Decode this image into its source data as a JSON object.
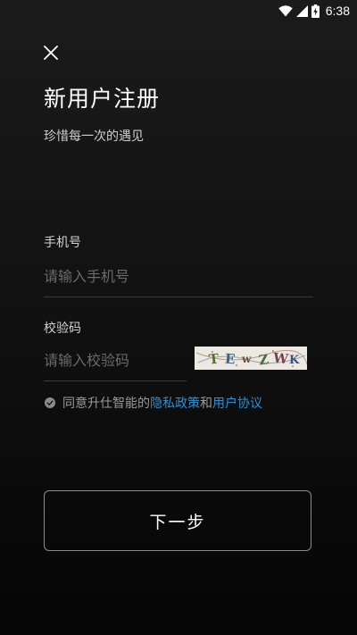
{
  "status_bar": {
    "time": "6:38",
    "icons": [
      "wifi-icon",
      "signal-icon",
      "battery-charging-icon"
    ]
  },
  "header": {
    "close_icon": "close-icon",
    "title": "新用户注册",
    "subtitle": "珍惜每一次的遇见"
  },
  "form": {
    "phone": {
      "label": "手机号",
      "placeholder": "请输入手机号",
      "value": ""
    },
    "code": {
      "label": "校验码",
      "placeholder": "请输入校验码",
      "value": "",
      "captcha_text": "TEWZWK"
    }
  },
  "agreement": {
    "checked": true,
    "prefix": "同意升仕智能的",
    "privacy_link": "隐私政策",
    "conjunction": "和",
    "user_link": "用户协议"
  },
  "actions": {
    "next_label": "下一步"
  },
  "colors": {
    "link": "#2f8fd6",
    "background": "#121212",
    "text": "#ffffff",
    "placeholder": "#6a6a6a"
  }
}
